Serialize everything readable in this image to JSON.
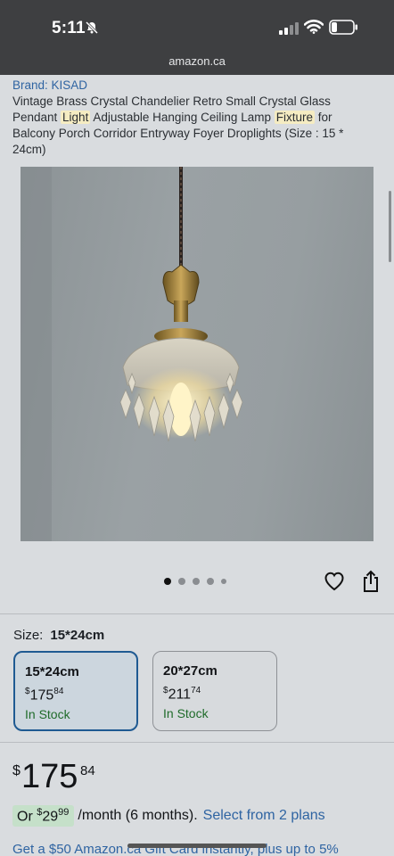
{
  "status_bar": {
    "time": "5:11"
  },
  "browser": {
    "url": "amazon.ca"
  },
  "product": {
    "brand": "Brand: KISAD",
    "title_parts": {
      "t1": "Vintage Brass Crystal Chandelier Retro Small Crystal Glass Pendant ",
      "h1": "Light",
      "t2": " Adjustable Hanging Ceiling Lamp ",
      "h2": "Fixture",
      "t3": " for Balcony Porch Corridor Entryway Foyer Droplights (Size : 15 * 24cm)"
    },
    "image_icon": "crystal-pendant-lamp-photo"
  },
  "gallery": {
    "dot_count": 5,
    "active_index": 0
  },
  "size_selector": {
    "label": "Size:",
    "selected_value": "15*24cm",
    "options": [
      {
        "name": "15*24cm",
        "currency": "$",
        "whole": "175",
        "fraction": "84",
        "stock": "In Stock",
        "selected": true
      },
      {
        "name": "20*27cm",
        "currency": "$",
        "whole": "211",
        "fraction": "74",
        "stock": "In Stock",
        "selected": false
      }
    ]
  },
  "price": {
    "currency": "$",
    "whole": "175",
    "fraction": "84"
  },
  "monthly": {
    "prefix": "Or ",
    "currency": "$",
    "whole": "29",
    "fraction": "99",
    "per": "/month (6 months).",
    "link": "Select from 2 plans"
  },
  "promo": {
    "text": "Get a $50 Amazon.ca Gift Card instantly, plus up to 5%"
  },
  "colors": {
    "link": "#2f64a2",
    "stock_green": "#1f6b2a",
    "selected_border": "#1f5a92",
    "highlight": "#f5ecc2"
  }
}
